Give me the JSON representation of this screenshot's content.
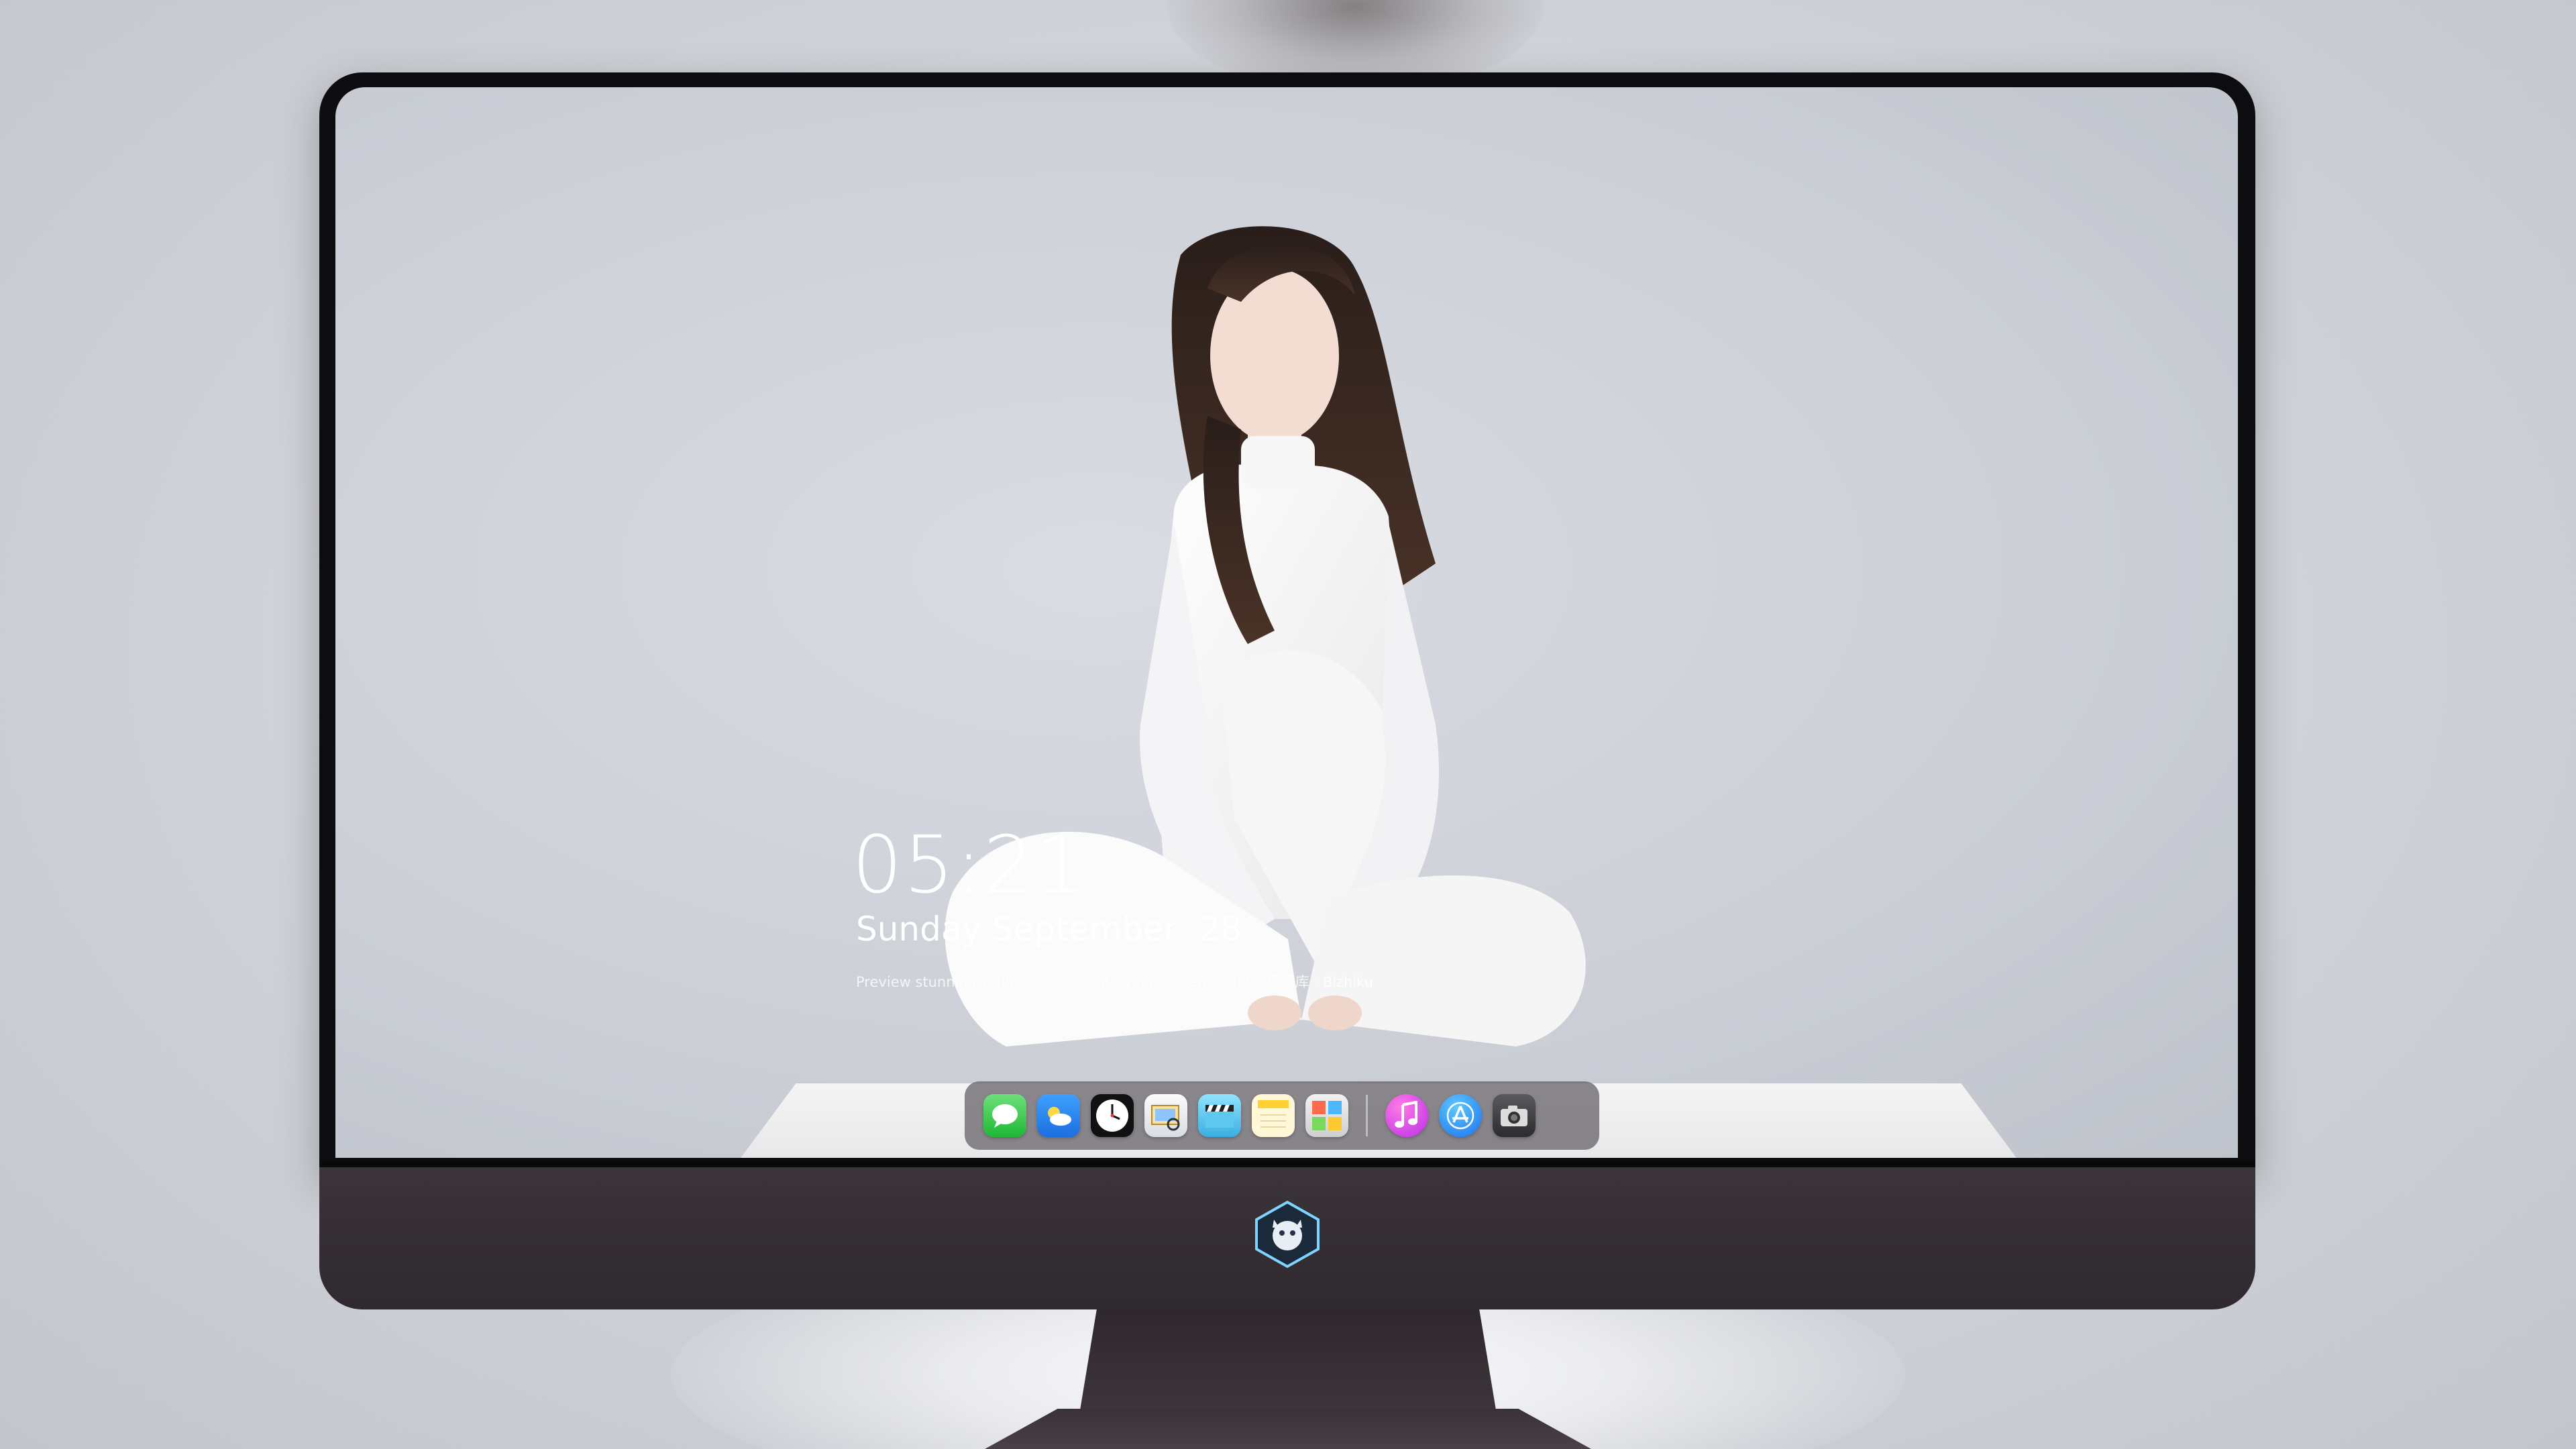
{
  "lockscreen": {
    "time": "05:21",
    "date": "Sunday September  28",
    "caption": "Preview stunning wallpapers. Elevate your screen beauty. 壁纸库 · Bizhiku"
  },
  "dock": {
    "apps": [
      {
        "name": "Messages",
        "icon": "messages-icon"
      },
      {
        "name": "Weather",
        "icon": "weather-icon"
      },
      {
        "name": "Clock",
        "icon": "clock-icon"
      },
      {
        "name": "Preview",
        "icon": "preview-icon"
      },
      {
        "name": "Clips",
        "icon": "clapperboard-icon"
      },
      {
        "name": "Notes",
        "icon": "notes-icon"
      },
      {
        "name": "Photo Booth",
        "icon": "photo-booth-icon"
      },
      {
        "name": "iTunes",
        "icon": "music-note-icon"
      },
      {
        "name": "App Store",
        "icon": "app-store-icon"
      },
      {
        "name": "Camera",
        "icon": "camera-icon"
      }
    ]
  },
  "colors": {
    "background": "#cfd2d8",
    "bezel": "#0d0d0f",
    "chin": "#3b3438",
    "dock": "#5f5c62"
  }
}
